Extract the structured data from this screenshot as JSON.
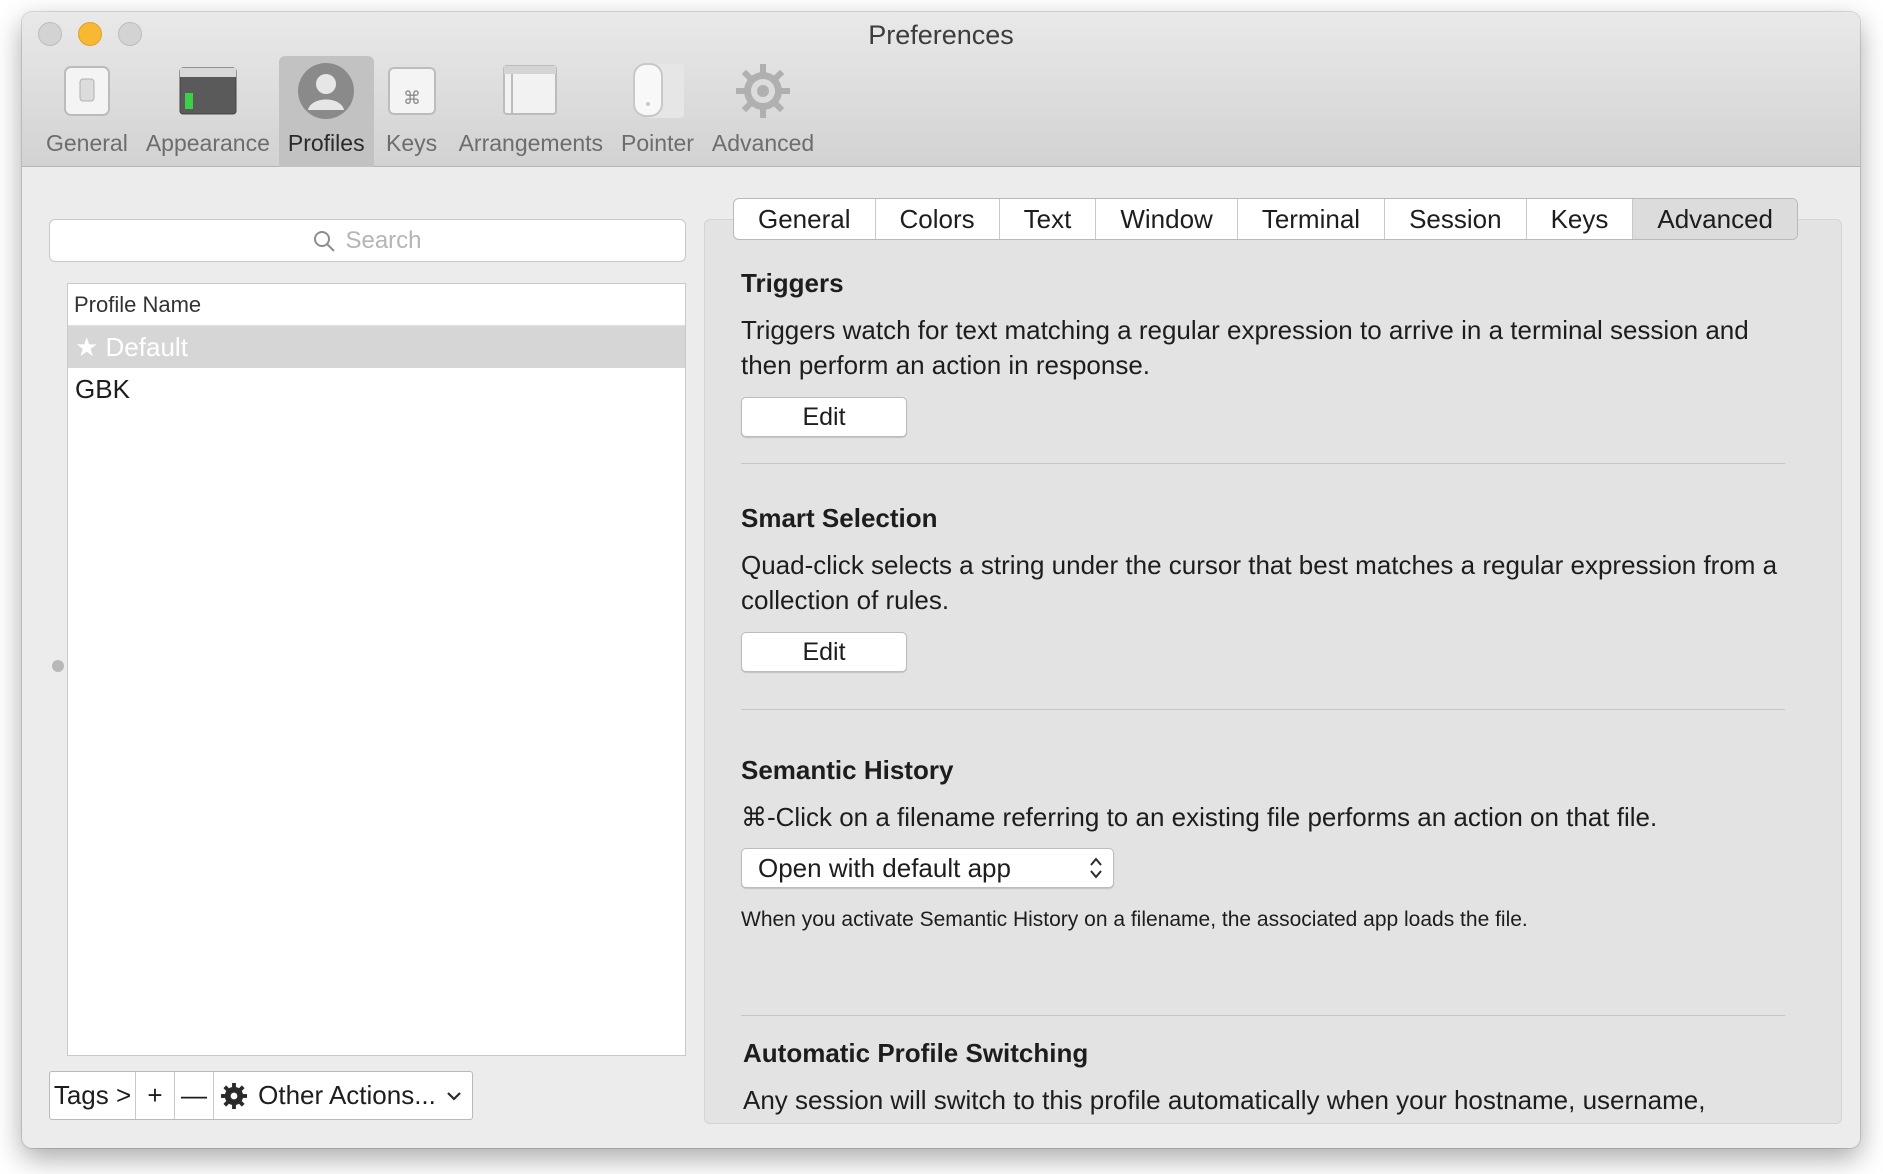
{
  "window": {
    "title": "Preferences"
  },
  "toolbar": {
    "items": [
      {
        "label": "General",
        "icon": "switch-icon"
      },
      {
        "label": "Appearance",
        "icon": "terminal-window-icon"
      },
      {
        "label": "Profiles",
        "icon": "user-silhouette-icon",
        "active": true
      },
      {
        "label": "Keys",
        "icon": "command-key-icon"
      },
      {
        "label": "Arrangements",
        "icon": "window-arrangement-icon"
      },
      {
        "label": "Pointer",
        "icon": "mouse-icon"
      },
      {
        "label": "Advanced",
        "icon": "gear-icon"
      }
    ]
  },
  "sidebar": {
    "search_placeholder": "Search",
    "column_header": "Profile Name",
    "profiles": [
      {
        "name": "★ Default",
        "selected": true
      },
      {
        "name": "GBK",
        "selected": false
      }
    ],
    "bottom": {
      "tags_label": "Tags >",
      "add_label": "+",
      "remove_label": "—",
      "other_actions_label": "Other Actions..."
    }
  },
  "tabs": [
    {
      "label": "General"
    },
    {
      "label": "Colors"
    },
    {
      "label": "Text"
    },
    {
      "label": "Window"
    },
    {
      "label": "Terminal"
    },
    {
      "label": "Session"
    },
    {
      "label": "Keys"
    },
    {
      "label": "Advanced",
      "active": true
    }
  ],
  "sections": {
    "triggers": {
      "title": "Triggers",
      "description": "Triggers watch for text matching a regular expression to arrive in a terminal session and then perform an action in response.",
      "button": "Edit"
    },
    "smart_selection": {
      "title": "Smart Selection",
      "description": "Quad-click selects a string under the cursor that best matches a regular expression from a collection of rules.",
      "button": "Edit"
    },
    "semantic_history": {
      "title": "Semantic History",
      "description": "⌘-Click on a filename referring to an existing file performs an action on that file.",
      "select_value": "Open with default app",
      "note": "When you activate Semantic History on a filename, the associated app loads the file."
    },
    "automatic_profile_switching": {
      "title": "Automatic Profile Switching",
      "description": "Any session will switch to this profile automatically when your hostname, username,"
    }
  },
  "colors": {
    "accent_traffic_yellow": "#f6b931",
    "selected_row": "#d6d6d6"
  }
}
